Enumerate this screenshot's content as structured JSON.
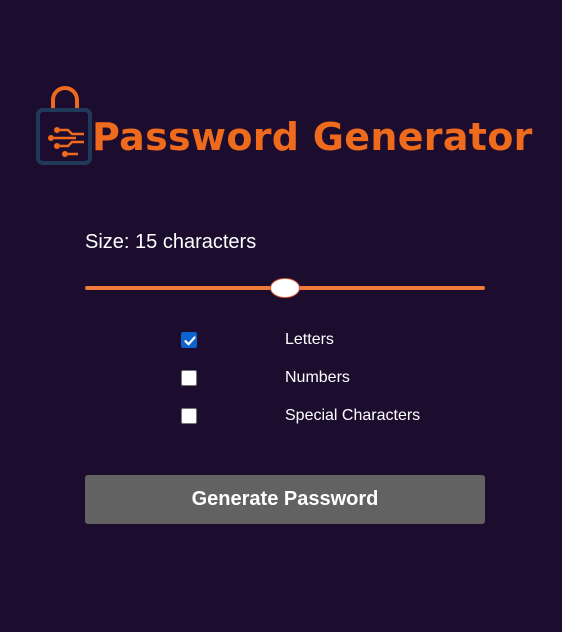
{
  "logo": {
    "text": "Password Generator",
    "icon": "padlock-circuit-icon",
    "color": "#ee6a1c"
  },
  "size": {
    "prefix": "Size:",
    "value": "15",
    "suffix": "characters",
    "slider_fraction": 0.5,
    "track_color": "#f07a3a"
  },
  "options": [
    {
      "label": "Letters",
      "checked": true
    },
    {
      "label": "Numbers",
      "checked": false
    },
    {
      "label": "Special Characters",
      "checked": false
    }
  ],
  "button": {
    "label": "Generate Password"
  },
  "colors": {
    "background": "#1c0c2e",
    "accent": "#ee6a1c",
    "checkbox_checked": "#0b63ce",
    "button": "#626262"
  }
}
